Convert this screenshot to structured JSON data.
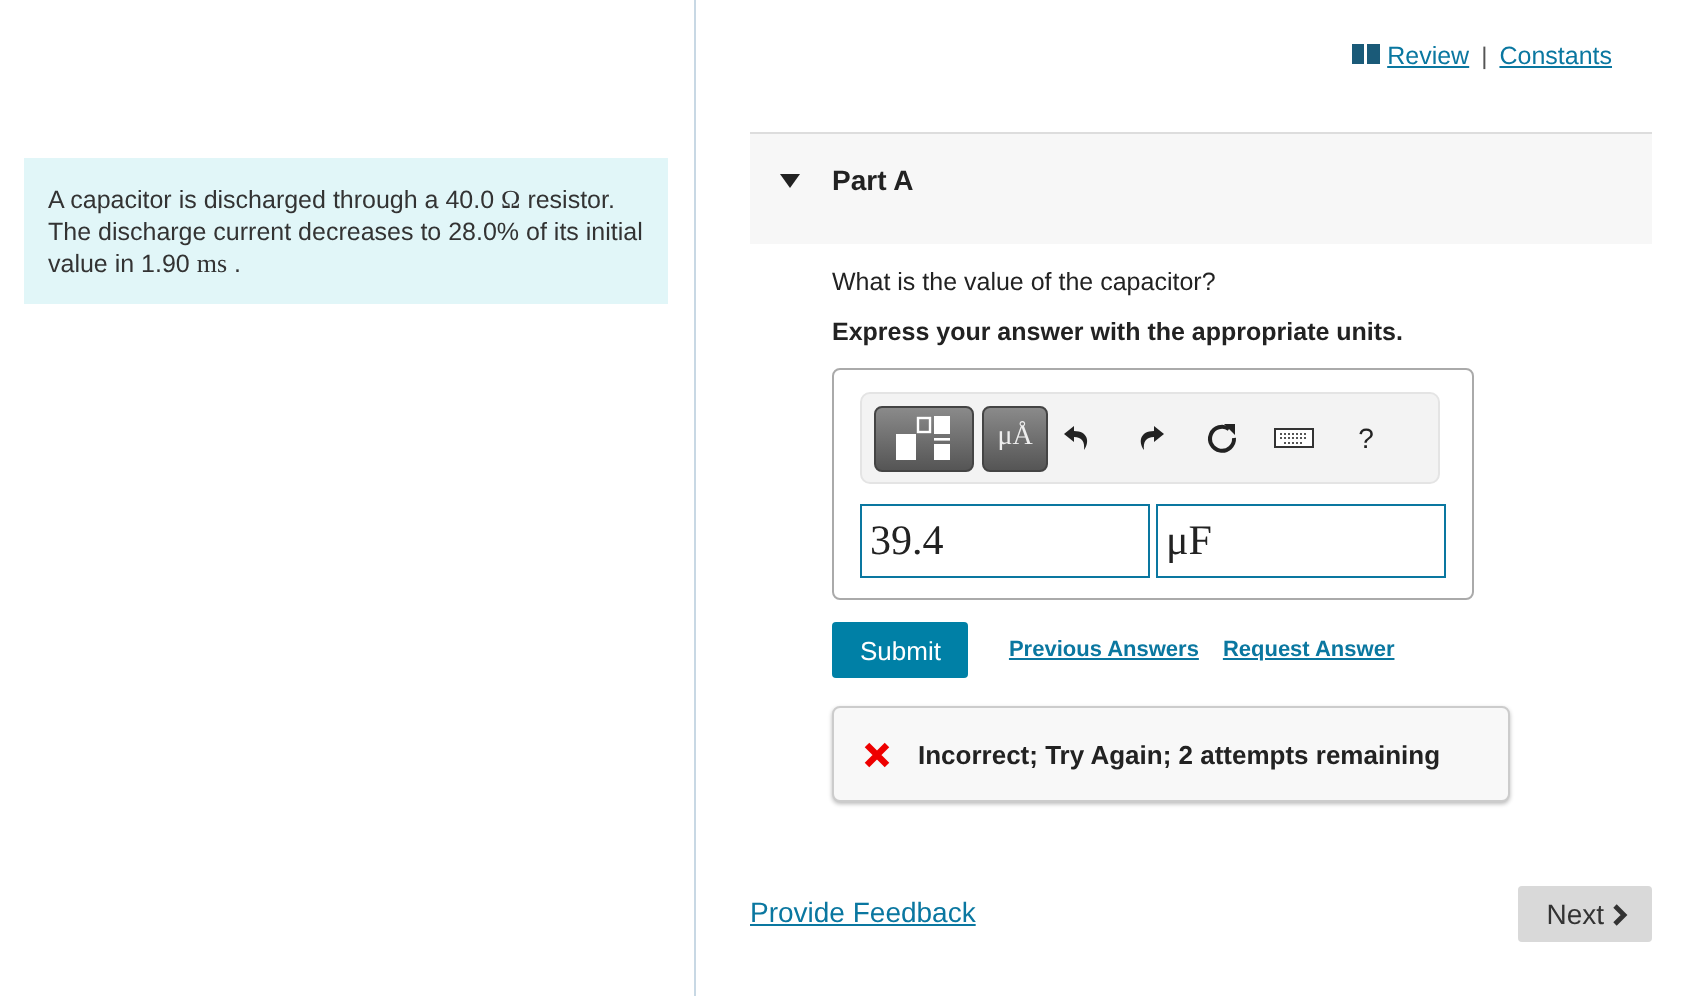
{
  "problem": {
    "segments": [
      {
        "kind": "text",
        "text": "A capacitor is discharged through a 40.0 "
      },
      {
        "kind": "math",
        "text": "Ω"
      },
      {
        "kind": "text",
        "text": " resistor. The discharge current decreases to 28.0% of its initial value in 1.90 "
      },
      {
        "kind": "math",
        "text": "ms"
      },
      {
        "kind": "text",
        "text": " ."
      }
    ]
  },
  "top_links": {
    "review": "Review",
    "separator": "|",
    "constants": "Constants"
  },
  "part": {
    "title": "Part A",
    "expanded": true,
    "question": "What is the value of the capacitor?",
    "instruction": "Express your answer with the appropriate units.",
    "toolbar": [
      {
        "kind": "templates"
      },
      {
        "kind": "units",
        "label": "μÅ"
      },
      {
        "kind": "undo"
      },
      {
        "kind": "redo"
      },
      {
        "kind": "reset"
      },
      {
        "kind": "keyboard"
      },
      {
        "kind": "help",
        "label": "?"
      }
    ],
    "value": "39.4",
    "unit": "μF",
    "submit": "Submit",
    "links": [
      "Previous Answers",
      "Request Answer"
    ],
    "feedback": {
      "kind": "incorrect",
      "text": "Incorrect; Try Again; 2 attempts remaining"
    }
  },
  "footer": {
    "feedback_link": "Provide Feedback",
    "next": "Next"
  }
}
